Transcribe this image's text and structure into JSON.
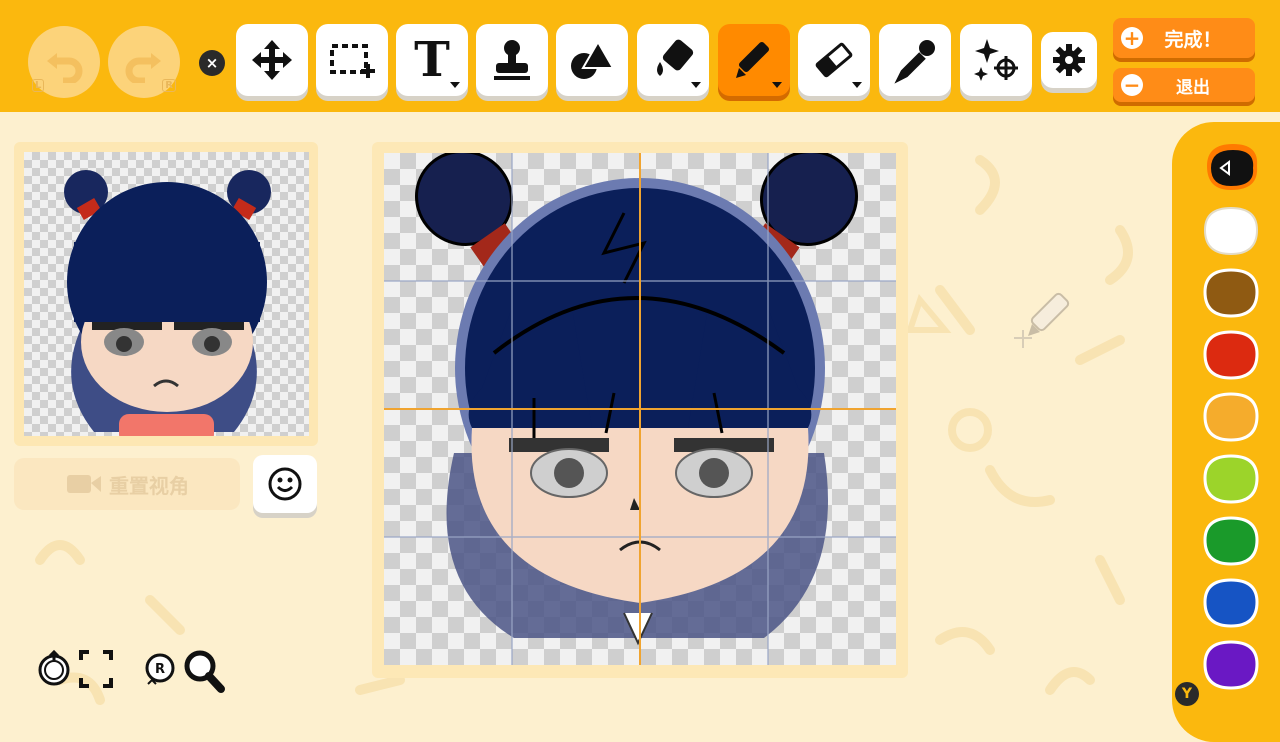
{
  "toolbar": {
    "undo_hint": "L",
    "redo_hint": "R",
    "close_label": "×",
    "tools": [
      {
        "name": "move-tool",
        "icon": "move-icon"
      },
      {
        "name": "select-tool",
        "icon": "selection-icon"
      },
      {
        "name": "text-tool",
        "icon": "text-icon",
        "label": "T"
      },
      {
        "name": "stamp-tool",
        "icon": "stamp-icon"
      },
      {
        "name": "shape-tool",
        "icon": "shapes-icon"
      },
      {
        "name": "fill-tool",
        "icon": "paint-bucket-icon"
      },
      {
        "name": "pen-tool",
        "icon": "pen-icon",
        "active": true
      },
      {
        "name": "eraser-tool",
        "icon": "eraser-icon"
      },
      {
        "name": "eyedropper-tool",
        "icon": "eyedropper-icon"
      },
      {
        "name": "effects-tool",
        "icon": "sparkle-icon"
      },
      {
        "name": "settings-button",
        "icon": "gear-icon"
      }
    ],
    "done_label": "完成！",
    "exit_label": "退出"
  },
  "preview": {
    "reset_view_label": "重置视角"
  },
  "palette": {
    "selected_index": 0,
    "colors": [
      "#111111",
      "#ffffff",
      "#8f5a12",
      "#dc2a10",
      "#f5ac2c",
      "#9cd42a",
      "#1a9a2a",
      "#1654c4",
      "#6a18c4"
    ]
  },
  "bottom_controls": {
    "zoom_hint": "R",
    "reset_hint": "L"
  },
  "y_button_label": "Y",
  "colors": {
    "toolbar": "#fbb80e",
    "active_tool": "#ff8a00",
    "background": "#fdf0cf",
    "hair": "#0b1f5a"
  }
}
